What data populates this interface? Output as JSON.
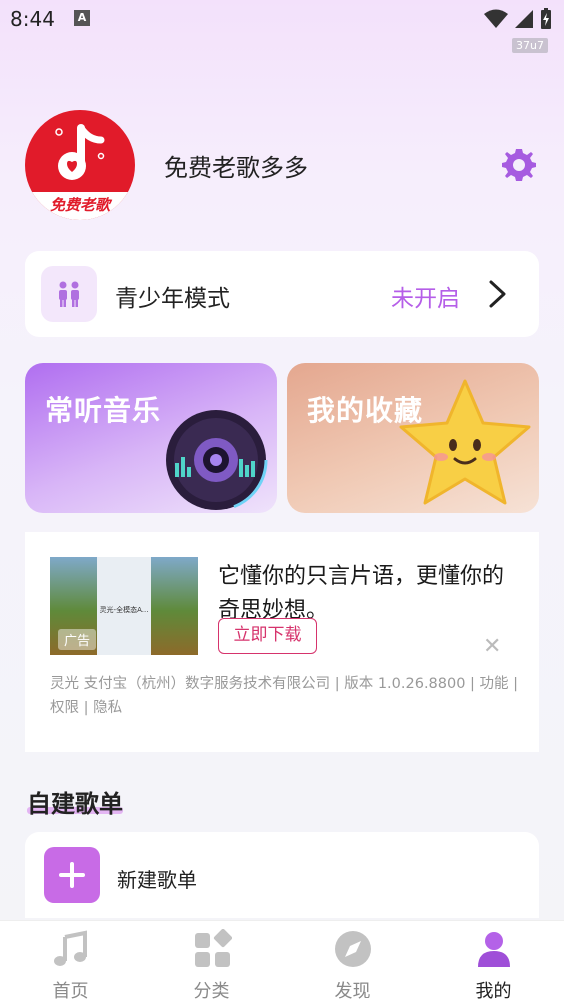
{
  "status_bar": {
    "time": "8:44",
    "badge": "37u7"
  },
  "profile": {
    "avatar_text": "免费老歌",
    "app_name": "免费老歌多多"
  },
  "youth_mode": {
    "label": "青少年模式",
    "status": "未开启"
  },
  "features": [
    {
      "title": "常听音乐"
    },
    {
      "title": "我的收藏"
    }
  ],
  "ad": {
    "image_text": "灵光-全模态A...",
    "tag": "广告",
    "title": "它懂你的只言片语，更懂你的奇思妙想。",
    "download_label": "立即下载",
    "meta": "灵光 支付宝（杭州）数字服务技术有限公司 | 版本 1.0.26.8800 | 功能 | 权限 | 隐私"
  },
  "playlists": {
    "section_title": "自建歌单",
    "new_label": "新建歌单"
  },
  "nav": [
    {
      "label": "首页",
      "icon": "music-note-icon"
    },
    {
      "label": "分类",
      "icon": "category-icon"
    },
    {
      "label": "发现",
      "icon": "compass-icon"
    },
    {
      "label": "我的",
      "icon": "user-icon",
      "active": true
    }
  ],
  "colors": {
    "accent": "#b55ee8",
    "brand_red": "#e11b2a",
    "ad_button": "#d6336c"
  }
}
